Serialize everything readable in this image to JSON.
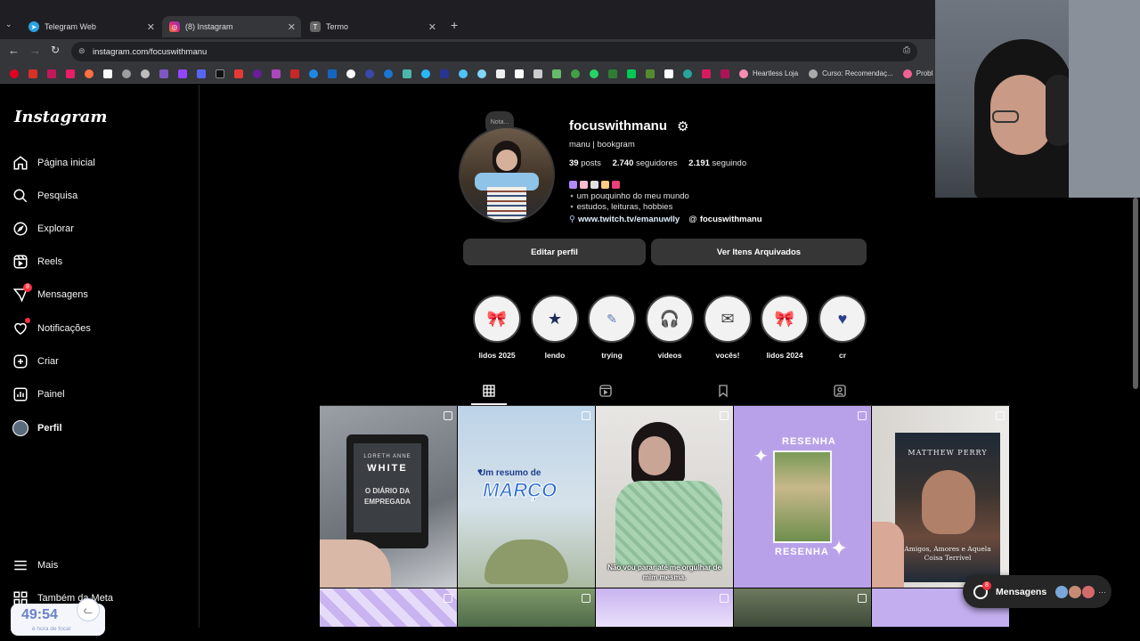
{
  "browser": {
    "tabs": [
      {
        "title": "Telegram Web",
        "favicon_color": "#2aa3e0"
      },
      {
        "title": "(8) Instagram",
        "favicon_color": "#d6249f"
      },
      {
        "title": "Termo",
        "favicon_color": "#666666"
      }
    ],
    "new_tab": "+",
    "url": "instagram.com/focuswithmanu",
    "bookmarks": {
      "heartless": "Heartless Loja",
      "curso": "Curso: Recomendaç...",
      "trunc": "Probl"
    }
  },
  "sidebar": {
    "logo": "Instagram",
    "items": [
      {
        "label": "Página inicial",
        "icon": "home-icon"
      },
      {
        "label": "Pesquisa",
        "icon": "search-icon"
      },
      {
        "label": "Explorar",
        "icon": "compass-icon"
      },
      {
        "label": "Reels",
        "icon": "reels-icon"
      },
      {
        "label": "Mensagens",
        "icon": "messenger-icon",
        "badge": "8"
      },
      {
        "label": "Notificações",
        "icon": "heart-icon"
      },
      {
        "label": "Criar",
        "icon": "plus-square-icon"
      },
      {
        "label": "Painel",
        "icon": "dashboard-icon"
      },
      {
        "label": "Perfil",
        "icon": "avatar"
      }
    ],
    "more": "Mais",
    "meta": "Também da Meta"
  },
  "timer": {
    "time": "49:54",
    "caption": "é hora de focar"
  },
  "profile": {
    "note": "Nota...",
    "username": "focuswithmanu",
    "display_name": "manu | bookgram",
    "posts_count": "39",
    "posts_label": "posts",
    "followers_count": "2.740",
    "followers_label": "seguidores",
    "following_count": "2.191",
    "following_label": "seguindo",
    "bio_line1": "⋆ um pouquinho do meu mundo",
    "bio_line2": "⋆ estudos, leituras, hobbies",
    "link": "www.twitch.tv/emanuwlly",
    "threads": "focuswithmanu",
    "edit_btn": "Editar perfil",
    "archive_btn": "Ver Itens Arquivados"
  },
  "highlights": [
    {
      "label": "lidos 2025",
      "glyph": "🎀"
    },
    {
      "label": "lendo",
      "glyph": "★"
    },
    {
      "label": "trying",
      "glyph": "✎"
    },
    {
      "label": "videos",
      "glyph": "🎧"
    },
    {
      "label": "vocês!",
      "glyph": "✉"
    },
    {
      "label": "lidos 2024",
      "glyph": "🎀"
    },
    {
      "label": "cr",
      "glyph": "♥"
    }
  ],
  "grid_posts": {
    "p1_author": "LORETH ANNE",
    "p1_title": "WHITE",
    "p1_sub": "O DIÁRIO DA EMPREGADA",
    "p2_line1": "Um resumo de",
    "p2_line2": "MARÇO",
    "p3_caption": "Não vou parar até me orgulhar de mim mesma.",
    "p4_top": "RESENHA",
    "p4_bottom": "RESENHA",
    "p5_author": "MATTHEW PERRY",
    "p5_title": "Amigos, Amores e Aquela Coisa Terrível"
  },
  "messages_pill": {
    "label": "Mensagens",
    "badge": "8"
  },
  "colors": {
    "accent_link": "#e0f1ff",
    "badge": "#ff3040",
    "button": "#363636",
    "lavender": "#c9b3f0"
  }
}
